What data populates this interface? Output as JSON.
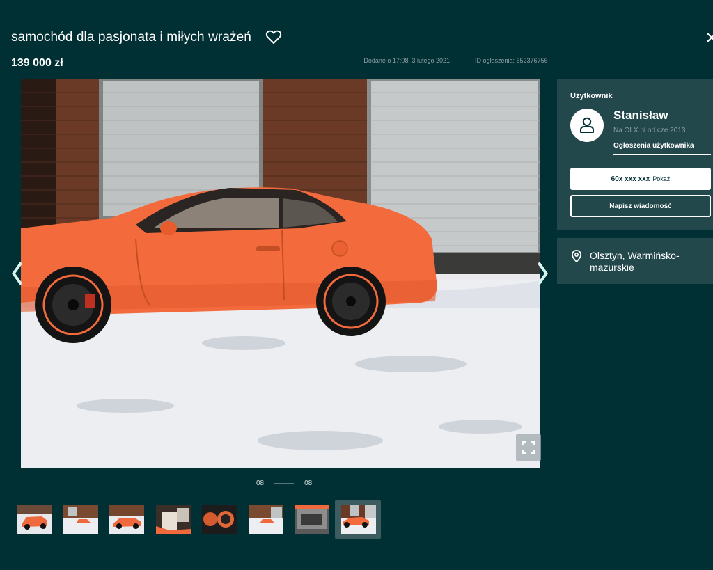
{
  "listing": {
    "title": "samochód dla pasjonata i miłych wrażeń",
    "price": "139 000 zł",
    "added": "Dodane o 17:08, 3 lutego 2021",
    "ad_id": "ID ogłoszenia: 652376756"
  },
  "gallery": {
    "current": "08",
    "total": "08",
    "thumbnail_count": 8,
    "active_thumbnail": 8
  },
  "user": {
    "section_title": "Użytkownik",
    "name": "Stanisław",
    "since": "Na OLX.pl od cze 2013",
    "ads_link": "Ogłoszenia użytkownika",
    "phone": "60x xxx xxx",
    "phone_show": "Pokaż",
    "message_button": "Napisz wiadomość"
  },
  "location": {
    "text": "Olsztyn, Warmińsko-mazurskie"
  },
  "colors": {
    "background": "#002f34",
    "card": "#23484c",
    "arrow_accent": "#d5f5ef",
    "car": "#f36a3c"
  },
  "icons": [
    "heart-icon",
    "close-icon",
    "user-icon",
    "pin-icon",
    "chevron-left-icon",
    "chevron-right-icon",
    "expand-icon"
  ]
}
